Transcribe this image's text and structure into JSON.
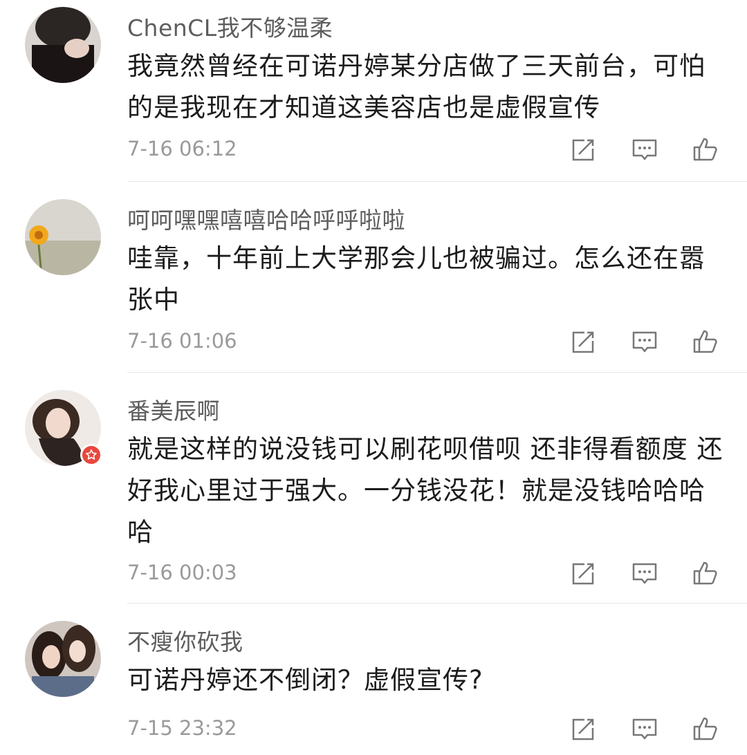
{
  "comments": [
    {
      "username": "ChenCL我不够温柔",
      "text": "我竟然曾经在可诺丹婷某分店做了三天前台，可怕的是我现在才知道这美容店也是虚假宣传",
      "time": "7-16 06:12",
      "avatar_icon": "avatar-dark-portrait"
    },
    {
      "username": "呵呵嘿嘿嘻嘻哈哈呼呼啦啦",
      "text": "哇靠，十年前上大学那会儿也被骗过。怎么还在嚣张中",
      "time": "7-16 01:06",
      "avatar_icon": "avatar-yellow-flower"
    },
    {
      "username": "番美辰啊",
      "text": "就是这样的说没钱可以刷花呗借呗 还非得看额度 还好我心里过于强大。一分钱没花！就是没钱哈哈哈哈",
      "time": "7-16 00:03",
      "avatar_icon": "avatar-girl-portrait",
      "badge_icon": "star-badge-icon"
    },
    {
      "username": "不瘦你砍我",
      "text": "可诺丹婷还不倒闭？虚假宣传?",
      "time": "7-15 23:32",
      "avatar_icon": "avatar-two-girls"
    }
  ],
  "actions": {
    "share_icon": "share-edit-icon",
    "reply_icon": "comment-icon",
    "like_icon": "thumbs-up-icon"
  },
  "colors": {
    "username": "#5d5d5d",
    "text": "#1c1c1c",
    "time": "#9a9a9a",
    "badge": "#e8473c"
  }
}
